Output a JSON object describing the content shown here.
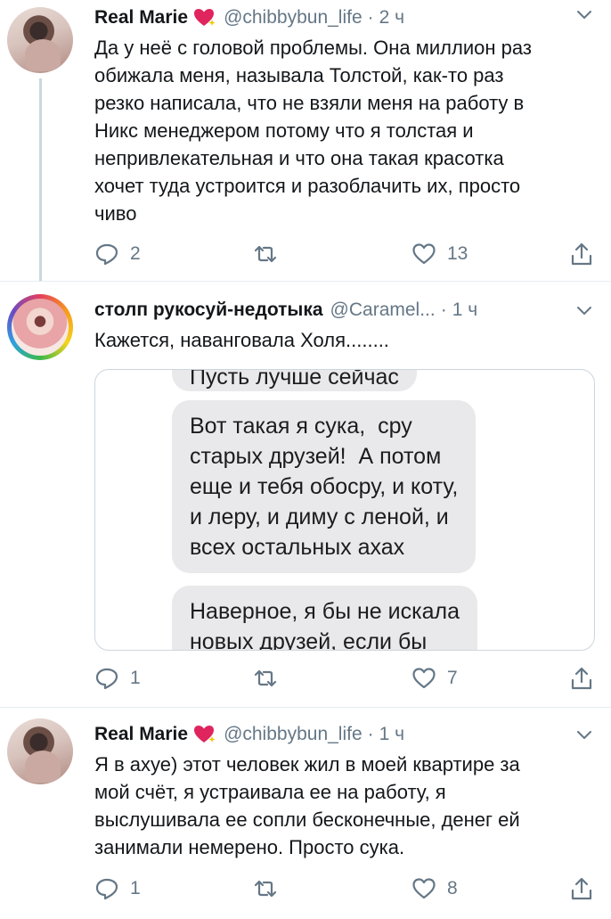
{
  "tweets": [
    {
      "author": "Real Marie",
      "handle": "@chibbybun_life",
      "time": "2 ч",
      "text": "Да у неё с головой проблемы. Она миллион раз\nобижала меня, называла Толстой, как-то раз\nрезко написала, что не взяли меня на работу в\nНикс менеджером потому что я толстая и\nнепривлекательная и что она такая красотка\nхочет туда устроится и разоблачить их, просто\nчиво",
      "replies": "2",
      "retweets": "",
      "likes": "13"
    },
    {
      "author": "столп рукосуй-недотыка",
      "handle": "@Caramel...",
      "time": "1 ч",
      "text": "Кажется, наванговала Холя........",
      "media": {
        "bubble_top": "Пусть лучше сейчас",
        "bubble_middle": "Вот такая я сука,  сру\nстарых друзей!  А потом\nеще и тебя обосру, и коту,\nи леру, и диму с леной, и\nвсех остальных ахах",
        "bubble_bottom": "Наверное, я бы не искала\nновых друзей, если бы"
      },
      "replies": "1",
      "retweets": "",
      "likes": "7"
    },
    {
      "author": "Real Marie",
      "handle": "@chibbybun_life",
      "time": "1 ч",
      "text": "Я в ахуе) этот человек жил в моей квартире за\nмой счёт, я устраивала ее на работу, я\nвыслушивала ее сопли бесконечные, денег ей\nзанимали немерено. Просто сука.",
      "replies": "1",
      "retweets": "",
      "likes": "8"
    }
  ],
  "dot": "·",
  "icons": {
    "reply": "reply-icon",
    "retweet": "retweet-icon",
    "like": "heart-icon",
    "share": "share-icon",
    "more": "chevron-down-icon",
    "badge": "sparkling-heart-icon"
  },
  "colors": {
    "text": "#14171a",
    "secondary": "#657786",
    "divider": "#e6ecf0",
    "thread_line": "#ccd6dd",
    "bubble": "#e9e9eb",
    "heart_badge": "#e0245e"
  }
}
